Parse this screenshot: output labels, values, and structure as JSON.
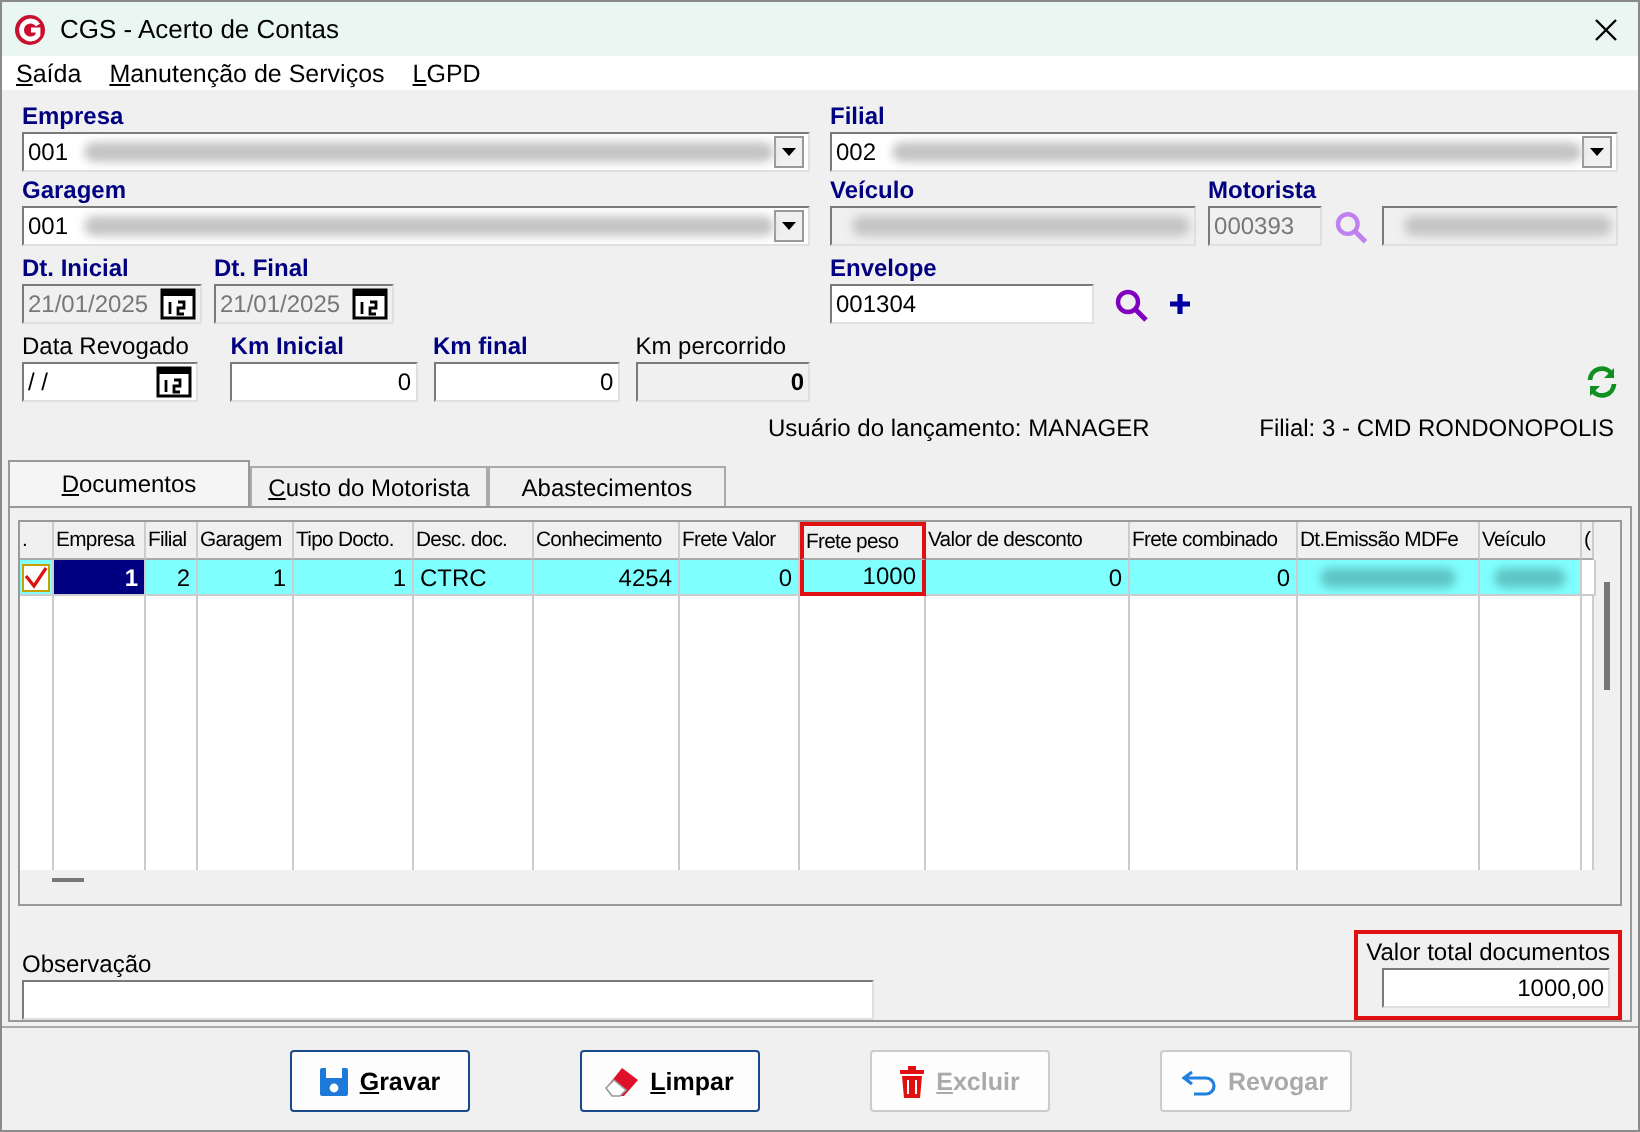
{
  "window": {
    "title": "CGS - Acerto de Contas"
  },
  "menu": [
    {
      "label": "Saída",
      "mnemonic": true
    },
    {
      "label": "Manutenção de Serviços",
      "mnemonic": true
    },
    {
      "label": "LGPD",
      "mnemonic": true
    }
  ],
  "form": {
    "empresa": {
      "label": "Empresa",
      "required": true,
      "value": "001",
      "redacted": true
    },
    "filial": {
      "label": "Filial",
      "required": true,
      "value": "002",
      "redacted": true
    },
    "garagem": {
      "label": "Garagem",
      "required": true,
      "value": "001",
      "redacted": true
    },
    "veiculo": {
      "label": "Veículo",
      "required": true,
      "redacted": true,
      "disabled": true
    },
    "motorista": {
      "label": "Motorista",
      "required": true,
      "value": "000393",
      "redacted": true,
      "disabled": true
    },
    "dt_inicial": {
      "label": "Dt. Inicial",
      "required": true,
      "value": "21/01/2025",
      "disabled": true
    },
    "dt_final": {
      "label": "Dt. Final",
      "required": true,
      "value": "21/01/2025",
      "disabled": true
    },
    "envelope": {
      "label": "Envelope",
      "required": true,
      "value": "001304"
    },
    "data_revogado": {
      "label": "Data Revogado",
      "required": false,
      "value": "/ /",
      "disabled": false
    },
    "km_inicial": {
      "label": "Km Inicial",
      "required": true,
      "value": "0",
      "disabled": false
    },
    "km_final": {
      "label": "Km final",
      "required": true,
      "value": "0",
      "disabled": false
    },
    "km_percorrido": {
      "label": "Km percorrido",
      "required": false,
      "value": "0",
      "disabled": true
    }
  },
  "info": {
    "user": "Usuário do lançamento: MANAGER",
    "branch": "Filial: 3 - CMD RONDONOPOLIS"
  },
  "tabs": [
    {
      "label": "Documentos",
      "selected": true,
      "mnemonic": true
    },
    {
      "label": "Custo do Motorista",
      "selected": false,
      "mnemonic": true
    },
    {
      "label": "Abastecimentos",
      "selected": false,
      "mnemonic": false
    }
  ],
  "table": {
    "columns": [
      {
        "label": ".",
        "highlighted": false
      },
      {
        "label": "Empresa",
        "highlighted": false
      },
      {
        "label": "Filial",
        "highlighted": false
      },
      {
        "label": "Garagem",
        "highlighted": false
      },
      {
        "label": "Tipo Docto.",
        "highlighted": false
      },
      {
        "label": "Desc. doc.",
        "highlighted": false
      },
      {
        "label": "Conhecimento",
        "highlighted": false
      },
      {
        "label": "Frete Valor",
        "highlighted": false
      },
      {
        "label": "Frete peso",
        "highlighted": true
      },
      {
        "label": "Valor de desconto",
        "highlighted": false
      },
      {
        "label": "Frete combinado",
        "highlighted": false
      },
      {
        "label": "Dt.Emissão MDFe",
        "highlighted": false
      },
      {
        "label": "Veículo",
        "highlighted": false
      },
      {
        "label": "(",
        "highlighted": false
      }
    ],
    "rows": [
      {
        "checked": true,
        "selected": true,
        "cells": [
          "",
          "1",
          "2",
          "1",
          "1",
          "CTRC",
          "4254",
          "0",
          "1000",
          "0",
          "0",
          "",
          "",
          ""
        ]
      }
    ]
  },
  "observacao": {
    "label": "Observação"
  },
  "total": {
    "label": "Valor total documentos",
    "value": "1000,00",
    "highlighted": true
  },
  "buttons": [
    {
      "label": "Gravar",
      "kind": "save",
      "disabled": false,
      "mnemonic": true
    },
    {
      "label": "Limpar",
      "kind": "clear",
      "disabled": false,
      "mnemonic": true
    },
    {
      "label": "Excluir",
      "kind": "delete",
      "disabled": true,
      "mnemonic": true
    },
    {
      "label": "Revogar",
      "kind": "revoke",
      "disabled": true,
      "mnemonic": false
    }
  ]
}
